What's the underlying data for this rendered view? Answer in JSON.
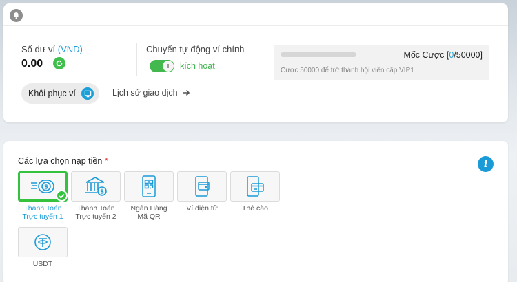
{
  "wallet": {
    "balance_label": "Số dư ví ",
    "currency": "(VND)",
    "balance": "0.00",
    "auto_switch_label": "Chuyển tự động ví chính",
    "auto_switch_status": "kích hoạt",
    "auto_switch_on": true,
    "bet_milestone": {
      "title_prefix": "Mốc Cược [",
      "current": "0",
      "target_suffix": "/50000]",
      "progress": 0,
      "note": "Cược 50000 để trở thành hội viên cấp VIP1"
    },
    "restore_label": "Khôi phục ví",
    "history_label": "Lịch sử giao dịch"
  },
  "deposit": {
    "title": "Các lựa chọn nạp tiền",
    "required_mark": "*",
    "options": [
      {
        "line1": "Thanh Toán",
        "line2": "Trực tuyến 1",
        "icon": "online-payment-coin-icon",
        "selected": true
      },
      {
        "line1": "Thanh Toán",
        "line2": "Trực tuyến 2",
        "icon": "bank-icon",
        "selected": false
      },
      {
        "line1": "Ngân Hàng",
        "line2": "Mã QR",
        "icon": "qr-phone-icon",
        "selected": false
      },
      {
        "line1": "Ví điện tử",
        "line2": "",
        "icon": "e-wallet-icon",
        "selected": false
      },
      {
        "line1": "Thẻ cào",
        "line2": "",
        "icon": "scratch-card-icon",
        "selected": false
      },
      {
        "line1": "USDT",
        "line2": "",
        "icon": "usdt-icon",
        "selected": false
      }
    ]
  },
  "colors": {
    "accent": "#1a9bd7",
    "success": "#34c23f",
    "toggle_on": "#43b84e"
  }
}
